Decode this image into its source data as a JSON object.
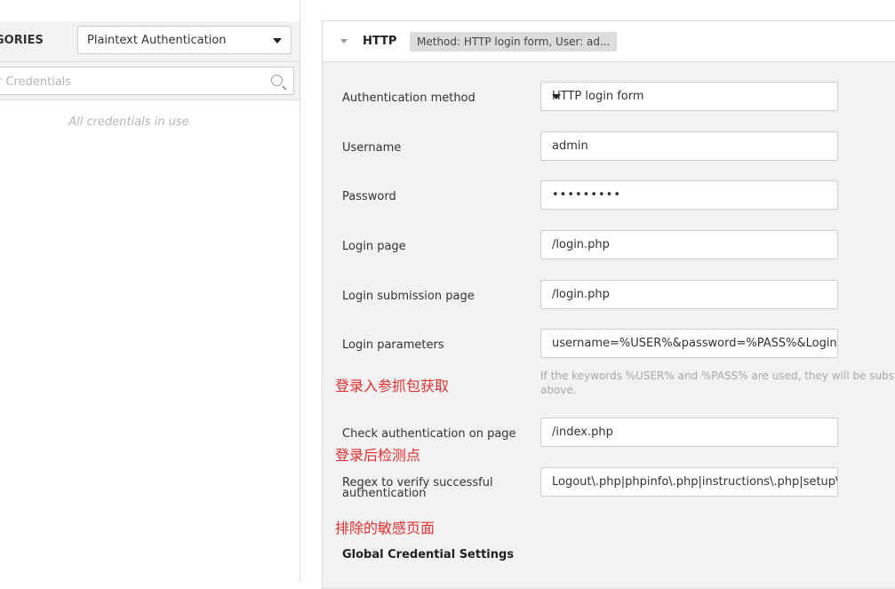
{
  "left_panel": {
    "categories_label": "GORIES",
    "category_selected": "Plaintext Authentication",
    "filter_placeholder": "r Credentials",
    "empty_message": "All credentials in use",
    "icons": {
      "search": "search-icon",
      "dropdown": "caret-down-icon"
    }
  },
  "section": {
    "title": "HTTP",
    "summary": "Method: HTTP login form, User: ad...",
    "collapse_icon": "triangle-down-icon"
  },
  "form": {
    "auth_method": {
      "label": "Authentication method",
      "value": "HTTP login form"
    },
    "username": {
      "label": "Username",
      "value": "admin"
    },
    "password": {
      "label": "Password",
      "value": "•••••••••"
    },
    "login_page": {
      "label": "Login page",
      "value": "/login.php"
    },
    "login_submission_page": {
      "label": "Login submission page",
      "value": "/login.php"
    },
    "login_parameters": {
      "label": "Login parameters",
      "value": "username=%USER%&password=%PASS%&Login=",
      "help": "If the keywords %USER% and %PASS% are used, they will be substit above."
    },
    "check_auth_page": {
      "label": "Check authentication on page",
      "value": "/index.php"
    },
    "regex_verify": {
      "label_line1": "Regex to verify successful",
      "label_line2": "authentication",
      "value": "Logout\\.php|phpinfo\\.php|instructions\\.php|setup\\"
    }
  },
  "annotations": {
    "login_params_note": "登录入参抓包获取",
    "check_page_note": "登录后检测点",
    "regex_note": "排除的敏感页面"
  },
  "global_settings_title": "Global Credential Settings",
  "colors": {
    "annotation": "#e03030",
    "panel_bg": "#f2f2f2",
    "border": "#dcdcdc"
  }
}
